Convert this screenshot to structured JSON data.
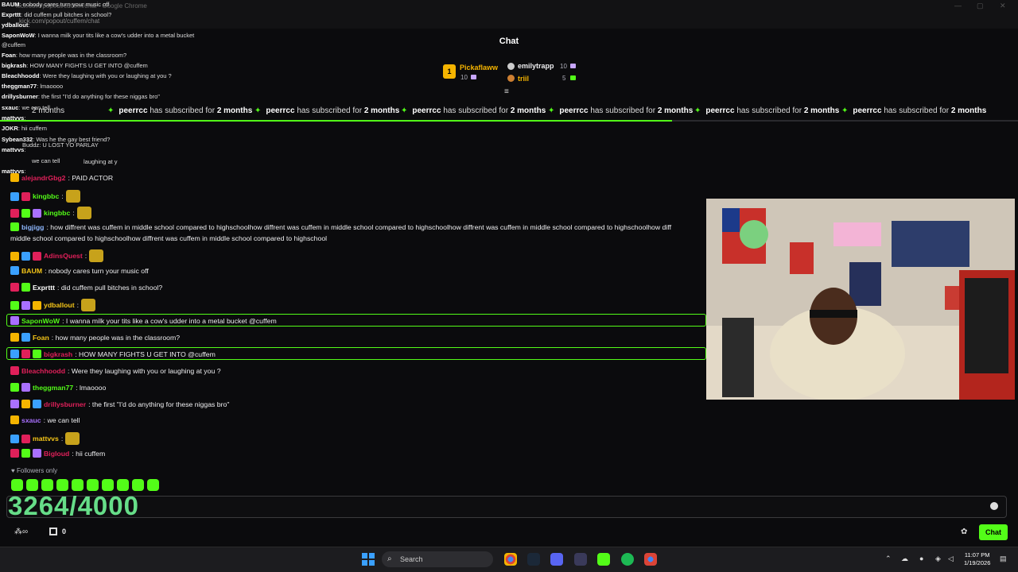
{
  "browser": {
    "title": "kick.com/popout/cuffem/chat - Google Chrome",
    "url": "kick.com/popout/cuffem/chat"
  },
  "chat": {
    "title": "Chat",
    "followers_only": "Followers only"
  },
  "gifters": [
    {
      "name": "Pickaflaww",
      "rank": "1",
      "count": "10"
    },
    {
      "name": "emilytrapp",
      "count": "10"
    },
    {
      "name": "triil",
      "count": "5"
    }
  ],
  "subscription": {
    "user": "peerrcc",
    "text": "has subscribed for",
    "months": "2 months"
  },
  "progress": 0.66,
  "overlay": [
    {
      "user": "BAUM",
      "text": ": nobody cares turn your music off"
    },
    {
      "user": "Exprttt",
      "text": ": did cuffem pull bitches in school?"
    },
    {
      "user": "ydballout",
      "text": ":"
    },
    {
      "user": "SaponWoW",
      "text": ": I wanna milk your tits like a cow's udder into a metal bucket"
    },
    {
      "user": "",
      "text": "@cuffem"
    },
    {
      "user": "Foan",
      "text": ": how many people was in the classroom?"
    },
    {
      "user": "bigkrash",
      "text": ": HOW MANY FIGHTS U GET INTO @cuffem"
    },
    {
      "user": "Bleachhoodd",
      "text": ": Were they laughing with you or laughing at you ?"
    },
    {
      "user": "theggman77",
      "text": ": lmaoooo"
    },
    {
      "user": "drillysburner",
      "text": ": the first \"I'd do anything for these niggas bro\""
    },
    {
      "user": "sxauc",
      "text": ": we can tell"
    },
    {
      "user": "mattvvs",
      "text": ":"
    },
    {
      "user": "JOKR",
      "text": ": hii cuffem"
    },
    {
      "user": "Sybean332",
      "text": ": Was he the gay best friend?"
    },
    {
      "user": "mattvvs",
      "text": ":"
    },
    {
      "user": "mattvvs",
      "text": ":"
    }
  ],
  "ghost": [
    {
      "text": "Buddz: U LOST YO PARLAY"
    },
    {
      "text": "laughing at y"
    },
    {
      "text": "we can tell"
    }
  ],
  "messages": [
    {
      "user": "alejandrGbg2",
      "text": ": PAID ACTOR",
      "color": "#e0205a"
    },
    {
      "user": "kingbbc",
      "text": ":",
      "color": "#53fc18"
    },
    {
      "user": "kingbbc",
      "text": ":",
      "color": "#53fc18"
    },
    {
      "user": "bigjigg",
      "text": ": how diffrent was cuffem in middle school compared to highschoolhow diffrent was cuffem in middle school compared to highschoolhow diffrent was cuffem in middle school compared to highschoolhow diff",
      "color": "#8fb8ff"
    },
    {
      "user": "",
      "text": "middle school compared to highschoolhow diffrent was cuffem in middle school compared to highschool",
      "color": "#fff"
    },
    {
      "user": "AdinsQuest",
      "text": ":",
      "color": "#e0205a"
    },
    {
      "user": "BAUM",
      "text": ": nobody cares turn your music off",
      "color": "#f5c518"
    },
    {
      "user": "Exprttt",
      "text": ": did cuffem pull bitches in school?",
      "color": "#fff"
    },
    {
      "user": "ydballout",
      "text": ":",
      "color": "#f5c518"
    },
    {
      "user": "SaponWoW",
      "text": ": I wanna milk your tits like a cow's udder into a metal bucket @cuffem",
      "color": "#53fc18"
    },
    {
      "user": "Foan",
      "text": ": how many people was in the classroom?",
      "color": "#f5c518"
    },
    {
      "user": "bigkrash",
      "text": ": HOW MANY FIGHTS U GET INTO @cuffem",
      "color": "#e0205a"
    },
    {
      "user": "Bleachhoodd",
      "text": ": Were they laughing with you or laughing at you ?",
      "color": "#e0205a"
    },
    {
      "user": "theggman77",
      "text": ": lmaoooo",
      "color": "#53fc18"
    },
    {
      "user": "drillysburner",
      "text": ": the first \"I'd do anything for these niggas bro\"",
      "color": "#e0205a"
    },
    {
      "user": "sxauc",
      "text": ": we can tell",
      "color": "#a970ff"
    },
    {
      "user": "mattvvs",
      "text": ":",
      "color": "#f5c518"
    },
    {
      "user": "Bigloud",
      "text": ": hii cuffem",
      "color": "#e0205a"
    }
  ],
  "counter": "3264/4000",
  "bottom": {
    "viewers": "0",
    "chat_button": "Chat"
  },
  "taskbar": {
    "search": "Search",
    "time": "11:07 PM",
    "date": "1/19/2026"
  },
  "icons": [
    "search-icon",
    "settings-icon",
    "emoji-icon",
    "windows-start-icon",
    "chrome-icon",
    "steam-icon",
    "discord-icon",
    "spotify-icon",
    "kick-icon",
    "wifi-icon",
    "volume-icon",
    "battery-icon",
    "notification-icon"
  ]
}
